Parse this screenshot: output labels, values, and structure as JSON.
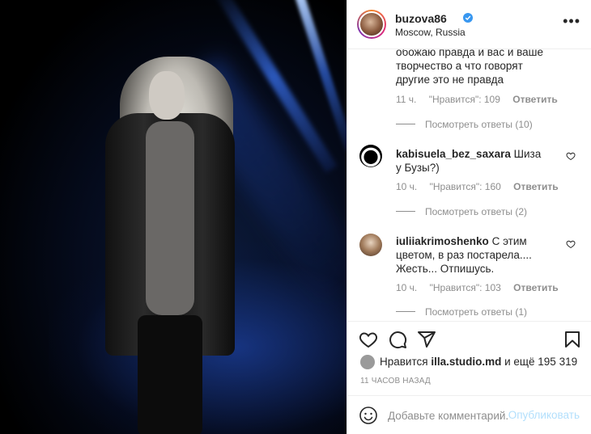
{
  "post": {
    "username": "buzova86",
    "location": "Moscow, Russia",
    "more_label": "•••"
  },
  "comments": [
    {
      "text": "обожаю правда и вас и ваше творчество а что говорят другие это не правда",
      "time": "11 ч.",
      "likes": "\"Нравится\": 109",
      "reply": "Ответить",
      "view_replies": "Посмотреть ответы (10)"
    },
    {
      "author": "kabisuela_bez_saxara",
      "text": "Шиза у Бузы?)",
      "time": "10 ч.",
      "likes": "\"Нравится\": 160",
      "reply": "Ответить",
      "view_replies": "Посмотреть ответы (2)"
    },
    {
      "author": "iuliiakrimoshenko",
      "text": "С этим цветом, в раз постарела.... Жесть... Отпишусь.",
      "time": "10 ч.",
      "likes": "\"Нравится\": 103",
      "reply": "Ответить",
      "view_replies": "Посмотреть ответы (1)"
    }
  ],
  "likes": {
    "prefix": "Нравится",
    "user": "illa.studio.md",
    "suffix": "и ещё 195 319"
  },
  "posted_time": "11 ЧАСОВ НАЗАД",
  "add_comment": {
    "placeholder": "Добавьте комментарий...",
    "publish_label": "Опубликовать"
  },
  "colors": {
    "link_blue": "#3897f0",
    "publish_disabled": "#b2dffc",
    "muted": "#8e8e8e"
  }
}
